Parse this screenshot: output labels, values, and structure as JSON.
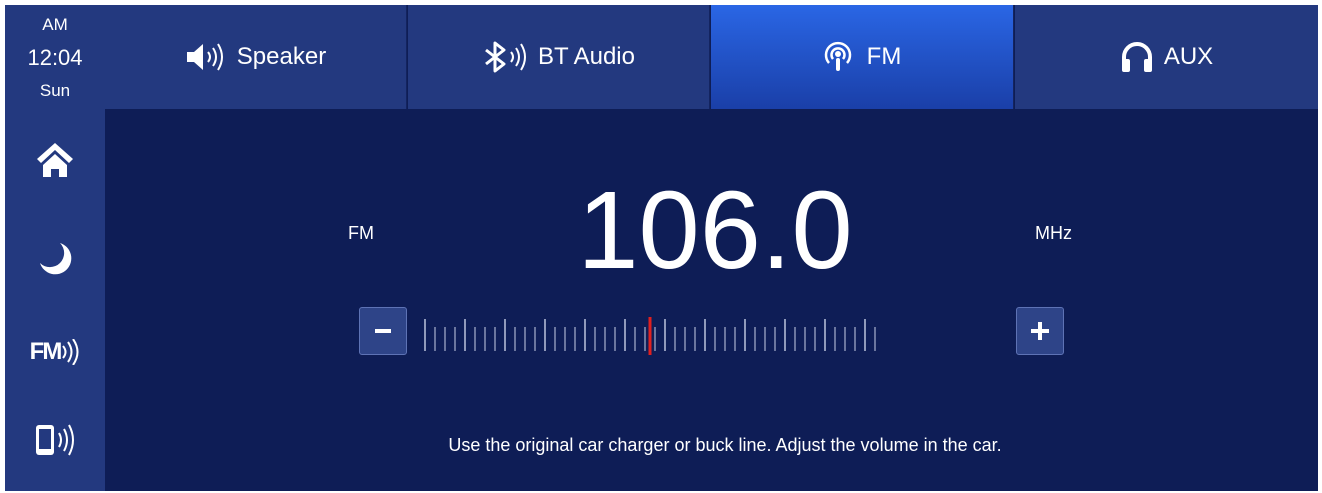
{
  "status": {
    "ampm": "AM",
    "time": "12:04",
    "day": "Sun"
  },
  "sidebar": {
    "items": [
      {
        "name": "home",
        "icon": "home-icon"
      },
      {
        "name": "night-mode",
        "icon": "moon-icon"
      },
      {
        "name": "fm-transmit",
        "icon": "fm-signal-icon",
        "label": "FM"
      },
      {
        "name": "phone-signal",
        "icon": "phone-signal-icon"
      }
    ]
  },
  "tabs": [
    {
      "label": "Speaker",
      "icon": "speaker-icon",
      "active": false
    },
    {
      "label": "BT Audio",
      "icon": "bluetooth-icon",
      "active": false
    },
    {
      "label": "FM",
      "icon": "podcast-icon",
      "active": true
    },
    {
      "label": "AUX",
      "icon": "headphones-icon",
      "active": false
    }
  ],
  "tuner": {
    "band": "FM",
    "frequency": "106.0",
    "unit": "MHz",
    "dial_position": 0.5
  },
  "hint": "Use the original car charger or buck line. Adjust the volume in the car.",
  "colors": {
    "background": "#0e1d56",
    "panel": "#23397f",
    "active_tab": "#2a66e5",
    "needle": "#e02020",
    "text": "#ffffff"
  }
}
